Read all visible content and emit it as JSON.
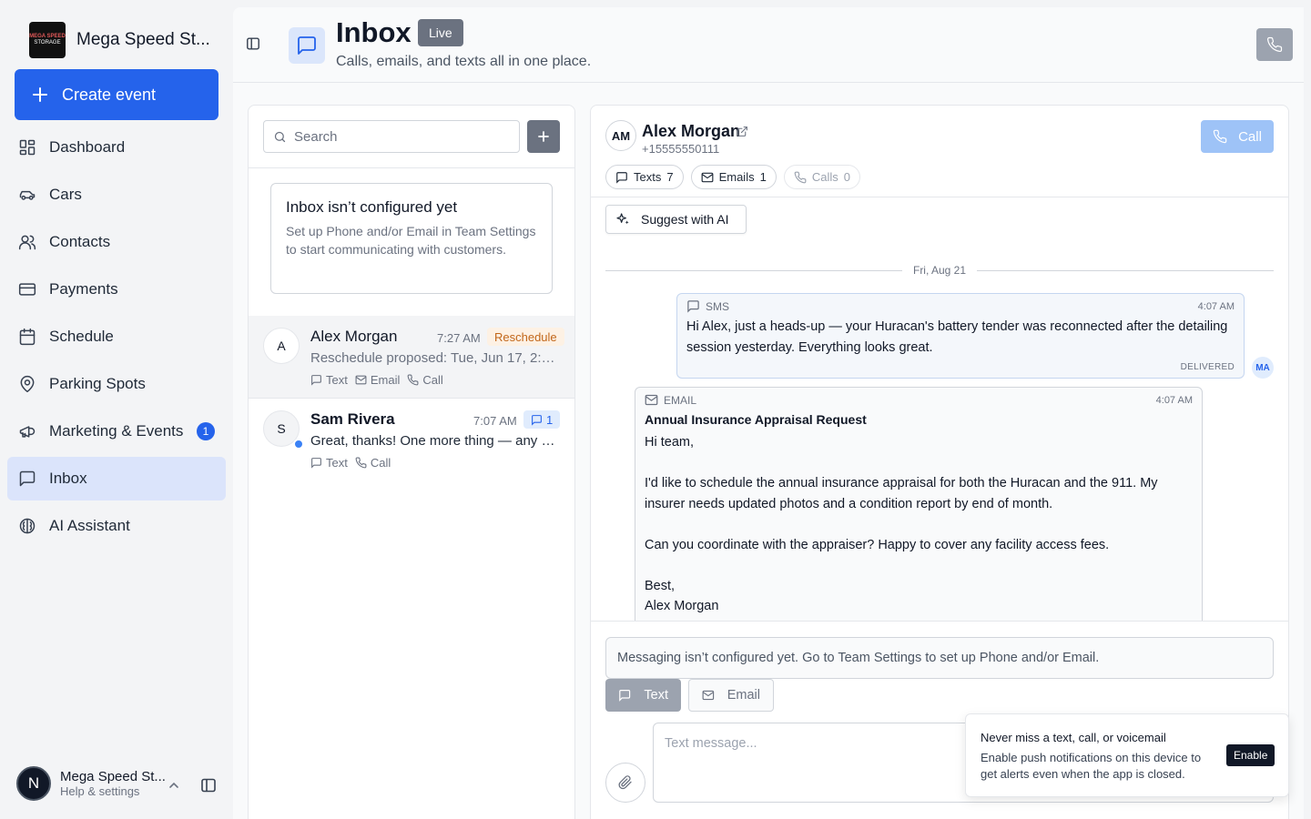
{
  "sidebar": {
    "brand_name": "Mega Speed St...",
    "logo_line1": "MEGA SPEED",
    "logo_line2": "STORAGE",
    "create_label": "Create event",
    "items": [
      {
        "label": "Dashboard",
        "icon": "dashboard-icon"
      },
      {
        "label": "Cars",
        "icon": "car-icon"
      },
      {
        "label": "Contacts",
        "icon": "contacts-icon"
      },
      {
        "label": "Payments",
        "icon": "credit-card-icon"
      },
      {
        "label": "Schedule",
        "icon": "calendar-icon"
      },
      {
        "label": "Parking Spots",
        "icon": "map-pin-icon"
      },
      {
        "label": "Marketing & Events",
        "icon": "megaphone-icon",
        "badge": "1"
      },
      {
        "label": "Inbox",
        "icon": "message-icon",
        "active": true
      },
      {
        "label": "AI Assistant",
        "icon": "brain-icon"
      }
    ],
    "user": {
      "initial": "N",
      "name": "Mega Speed St...",
      "sub": "Help & settings"
    }
  },
  "header": {
    "title": "Inbox",
    "live_label": "Live",
    "subtitle": "Calls, emails, and texts all in one place."
  },
  "list": {
    "search_placeholder": "Search",
    "notice_title": "Inbox isn’t configured yet",
    "notice_body": "Set up Phone and/or Email in Team Settings to start communicating with customers.",
    "conversations": [
      {
        "initial": "A",
        "name": "Alex Morgan",
        "time": "7:27 AM",
        "tag": "Reschedule",
        "preview": "Reschedule proposed: Tue, Jun 17, 2:00 ...",
        "channels": [
          "Text",
          "Email",
          "Call"
        ]
      },
      {
        "initial": "S",
        "name": "Sam Rivera",
        "time": "7:07 AM",
        "unread": "1",
        "preview": "Great, thanks! One more thing — any u...",
        "channels": [
          "Text",
          "Call"
        ]
      }
    ]
  },
  "thread": {
    "initials": "AM",
    "name": "Alex Morgan",
    "phone": "+15555550111",
    "call_label": "Call",
    "chips": {
      "texts_label": "Texts",
      "texts_count": "7",
      "emails_label": "Emails",
      "emails_count": "1",
      "calls_label": "Calls",
      "calls_count": "0"
    },
    "suggest_label": "Suggest with AI",
    "date_divider": "Fri, Aug 21",
    "sms": {
      "type": "SMS",
      "time": "4:07 AM",
      "body": "Hi Alex, just a heads-up — your Huracan's battery tender was reconnected after the detailing session yesterday. Everything looks great.",
      "status": "DELIVERED",
      "sender_initials": "MA"
    },
    "email": {
      "type": "EMAIL",
      "time": "4:07 AM",
      "subject": "Annual Insurance Appraisal Request",
      "body": "Hi team,\n\nI'd like to schedule the annual insurance appraisal for both the Huracan and the 911. My insurer needs updated photos and a condition report by end of month.\n\nCan you coordinate with the appraiser? Happy to cover any facility access fees.\n\nBest,\nAlex Morgan"
    },
    "composer": {
      "config_notice": "Messaging isn’t configured yet. Go to Team Settings to set up Phone and/or Email.",
      "text_label": "Text",
      "email_label": "Email",
      "placeholder": "Text message..."
    }
  },
  "toast": {
    "title": "Never miss a text, call, or voicemail",
    "body": "Enable push notifications on this device to get alerts even when the app is closed.",
    "button_label": "Enable"
  },
  "colors": {
    "primary": "#2563eb",
    "active_nav": "#dbe4fb",
    "reschedule_tag": "#c2671a"
  }
}
